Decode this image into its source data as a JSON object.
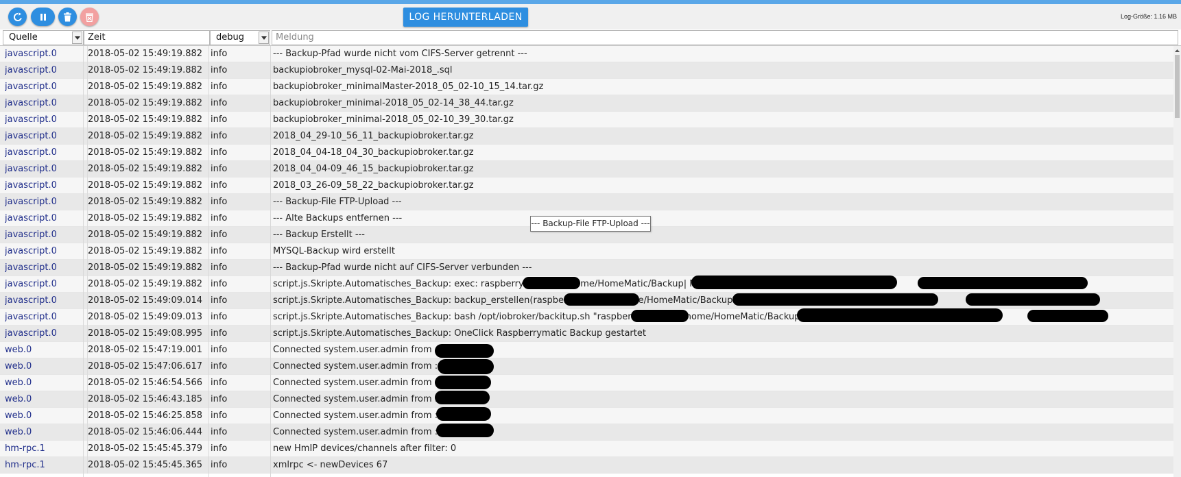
{
  "toolbar": {
    "download_label": "LOG HERUNTERLADEN",
    "log_size": "Log-Größe: 1.16 MB",
    "icons": [
      "refresh-icon",
      "pause-icon",
      "trash-icon",
      "delete-file-icon"
    ]
  },
  "filters": {
    "source_label": "Quelle",
    "time_label": "Zeit",
    "severity_selected": "debug",
    "message_placeholder": "Meldung"
  },
  "tooltip": "--- Backup-File FTP-Upload ---",
  "colors": {
    "accent": "#2e8ee0",
    "disabled": "#f2a0a0",
    "source_text": "#1f2d8a"
  },
  "rows": [
    {
      "source": "javascript.0",
      "time": "2018-05-02 15:49:19.882",
      "severity": "info",
      "message": "--- Backup-Pfad wurde nicht vom CIFS-Server getrennt ---"
    },
    {
      "source": "javascript.0",
      "time": "2018-05-02 15:49:19.882",
      "severity": "info",
      "message": "backupiobroker_mysql-02-Mai-2018_.sql"
    },
    {
      "source": "javascript.0",
      "time": "2018-05-02 15:49:19.882",
      "severity": "info",
      "message": "backupiobroker_minimalMaster-2018_05_02-10_15_14.tar.gz"
    },
    {
      "source": "javascript.0",
      "time": "2018-05-02 15:49:19.882",
      "severity": "info",
      "message": "backupiobroker_minimal-2018_05_02-14_38_44.tar.gz"
    },
    {
      "source": "javascript.0",
      "time": "2018-05-02 15:49:19.882",
      "severity": "info",
      "message": "backupiobroker_minimal-2018_05_02-10_39_30.tar.gz"
    },
    {
      "source": "javascript.0",
      "time": "2018-05-02 15:49:19.882",
      "severity": "info",
      "message": "2018_04_29-10_56_11_backupiobroker.tar.gz"
    },
    {
      "source": "javascript.0",
      "time": "2018-05-02 15:49:19.882",
      "severity": "info",
      "message": "2018_04_04-18_04_30_backupiobroker.tar.gz"
    },
    {
      "source": "javascript.0",
      "time": "2018-05-02 15:49:19.882",
      "severity": "info",
      "message": "2018_04_04-09_46_15_backupiobroker.tar.gz"
    },
    {
      "source": "javascript.0",
      "time": "2018-05-02 15:49:19.882",
      "severity": "info",
      "message": "2018_03_26-09_58_22_backupiobroker.tar.gz"
    },
    {
      "source": "javascript.0",
      "time": "2018-05-02 15:49:19.882",
      "severity": "info",
      "message": "--- Backup-File FTP-Upload ---"
    },
    {
      "source": "javascript.0",
      "time": "2018-05-02 15:49:19.882",
      "severity": "info",
      "message": "--- Alte Backups entfernen ---"
    },
    {
      "source": "javascript.0",
      "time": "2018-05-02 15:49:19.882",
      "severity": "info",
      "message": "--- Backup Erstellt ---"
    },
    {
      "source": "javascript.0",
      "time": "2018-05-02 15:49:19.882",
      "severity": "info",
      "message": "MYSQL-Backup wird erstellt"
    },
    {
      "source": "javascript.0",
      "time": "2018-05-02 15:49:19.882",
      "severity": "info",
      "message": "--- Backup-Pfad wurde nicht auf CIFS-Server verbunden ---"
    },
    {
      "source": "javascript.0",
      "time": "2018-05-02 15:49:19.882",
      "severity": "info",
      "message": "script.js.Skripte.Automatisches_Backup: exec: raspberrymatic||5|                    /home/HomeMatic/Backup|                                                                            NEIN|i"
    },
    {
      "source": "javascript.0",
      "time": "2018-05-02 15:49:09.014",
      "severity": "info",
      "message": "script.js.Skripte.Automatisches_Backup: backup_erstellen(raspberrymatic,,5                        /home/HomeMatic/Backup                                                 ,NEIN,"
    },
    {
      "source": "javascript.0",
      "time": "2018-05-02 15:49:09.013",
      "severity": "info",
      "message": "script.js.Skripte.Automatisches_Backup: bash /opt/iobroker/backitup.sh \"raspberrymatic||5|                    /home/HomeMatic/Backup|                                                                      NEIN|i"
    },
    {
      "source": "javascript.0",
      "time": "2018-05-02 15:49:08.995",
      "severity": "info",
      "message": "script.js.Skripte.Automatisches_Backup: OneClick Raspberrymatic Backup gestartet"
    },
    {
      "source": "web.0",
      "time": "2018-05-02 15:47:19.001",
      "severity": "info",
      "message": "Connected system.user.admin from ::ffff:"
    },
    {
      "source": "web.0",
      "time": "2018-05-02 15:47:06.617",
      "severity": "info",
      "message": "Connected system.user.admin from ::ffff:1"
    },
    {
      "source": "web.0",
      "time": "2018-05-02 15:46:54.566",
      "severity": "info",
      "message": "Connected system.user.admin from ::ffff:"
    },
    {
      "source": "web.0",
      "time": "2018-05-02 15:46:43.185",
      "severity": "info",
      "message": "Connected system.user.admin from ::ffff:"
    },
    {
      "source": "web.0",
      "time": "2018-05-02 15:46:25.858",
      "severity": "info",
      "message": "Connected system.user.admin from ::ffff:"
    },
    {
      "source": "web.0",
      "time": "2018-05-02 15:46:06.444",
      "severity": "info",
      "message": "Connected system.user.admin from ::ffff:"
    },
    {
      "source": "hm-rpc.1",
      "time": "2018-05-02 15:45:45.379",
      "severity": "info",
      "message": "new HmIP devices/channels after filter: 0"
    },
    {
      "source": "hm-rpc.1",
      "time": "2018-05-02 15:45:45.365",
      "severity": "info",
      "message": "xmlrpc <- newDevices 67"
    }
  ]
}
